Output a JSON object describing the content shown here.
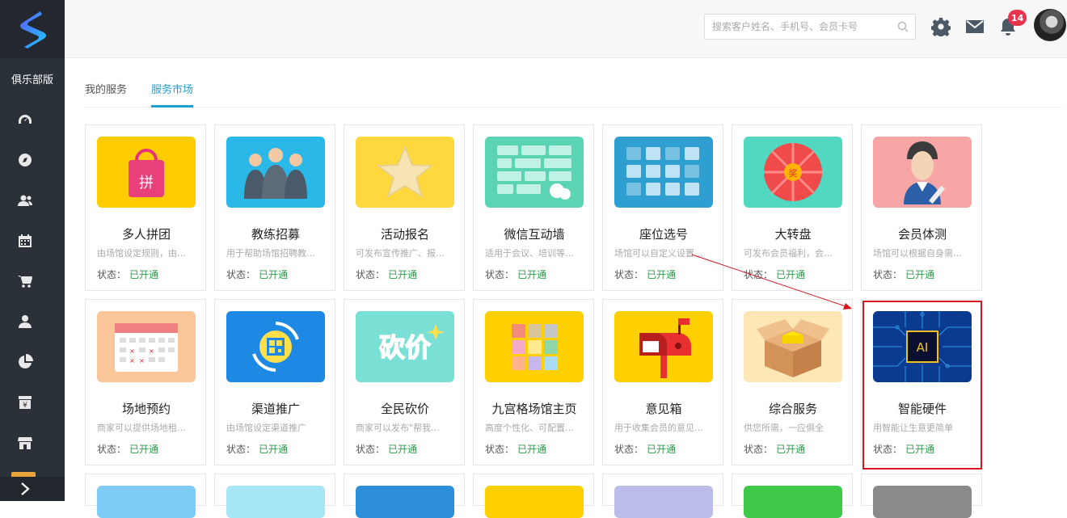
{
  "sidebar": {
    "club_label": "俱乐部版",
    "icons": [
      "dashboard-icon",
      "compass-icon",
      "users-icon",
      "calendar-icon",
      "cart-icon",
      "person-icon",
      "pie-chart-icon",
      "finance-icon",
      "store-icon"
    ],
    "collapse_icon": "chevron-right-icon"
  },
  "header": {
    "search_placeholder": "搜索客户姓名、手机号、会员卡号",
    "notification_count": "14"
  },
  "tabs": [
    {
      "label": "我的服务",
      "active": false
    },
    {
      "label": "服务市场",
      "active": true
    }
  ],
  "status_label": "状态：",
  "cards": [
    {
      "title": "多人拼团",
      "desc": "由场馆设定规则，由…",
      "status": "已开通",
      "color": "#ffcc00"
    },
    {
      "title": "教练招募",
      "desc": "用于帮助场馆招聘教…",
      "status": "已开通",
      "color": "#29b8e8"
    },
    {
      "title": "活动报名",
      "desc": "可发布宣传推广、报…",
      "status": "已开通",
      "color": "#ffd83d"
    },
    {
      "title": "微信互动墙",
      "desc": "适用于会议、培训等…",
      "status": "已开通",
      "color": "#5bd4b4"
    },
    {
      "title": "座位选号",
      "desc": "场馆可以自定义设置…",
      "status": "已开通",
      "color": "#2e9fd0"
    },
    {
      "title": "大转盘",
      "desc": "可发布会员福利，会…",
      "status": "已开通",
      "color": "#52d8c0"
    },
    {
      "title": "会员体测",
      "desc": "场馆可以根据自身需…",
      "status": "已开通",
      "color": "#f7a5a5"
    },
    {
      "title": "场地预约",
      "desc": "商家可以提供场地租…",
      "status": "已开通",
      "color": "#fbc79a"
    },
    {
      "title": "渠道推广",
      "desc": "由场馆设定渠道推广",
      "status": "已开通",
      "color": "#1e88e5"
    },
    {
      "title": "全民砍价",
      "desc": "商家可以发布\"帮我…",
      "status": "已开通",
      "color": "#7ae0d6"
    },
    {
      "title": "九宫格场馆主页",
      "desc": "高度个性化、可配置…",
      "status": "已开通",
      "color": "#ffd000"
    },
    {
      "title": "意见箱",
      "desc": "用于收集会员的意见…",
      "status": "已开通",
      "color": "#ffd000"
    },
    {
      "title": "综合服务",
      "desc": "供您所需，一应俱全",
      "status": "已开通",
      "color": "#fde7b5"
    },
    {
      "title": "智能硬件",
      "desc": "用智能让生意更简单",
      "status": "已开通",
      "color": "#0a3b8f"
    }
  ],
  "row3_colors": [
    "#7ecbf5",
    "#a7e6f5",
    "#2d8fd8",
    "#ffd000",
    "#b9bde8",
    "#3ec94a",
    "#8a8a8a"
  ]
}
